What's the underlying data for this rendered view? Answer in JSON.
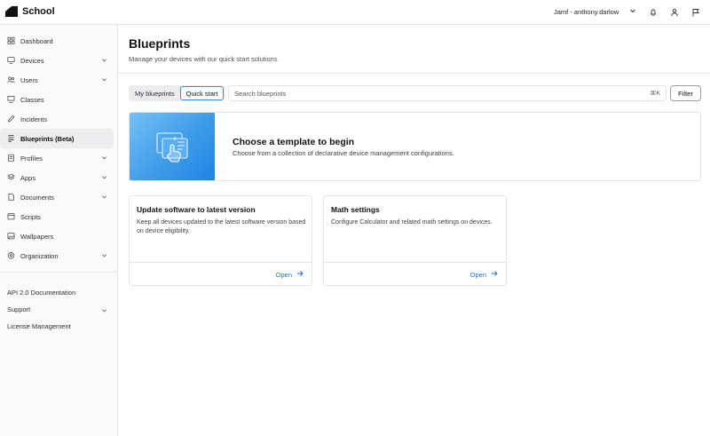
{
  "app": {
    "name": "School",
    "account": "Jamf - anthony.darlow"
  },
  "sidebar": {
    "items": [
      {
        "label": "Dashboard",
        "icon": "grid-icon",
        "chevron": false
      },
      {
        "label": "Devices",
        "icon": "monitor-icon",
        "chevron": true
      },
      {
        "label": "Users",
        "icon": "users-icon",
        "chevron": true
      },
      {
        "label": "Classes",
        "icon": "classroom-icon",
        "chevron": false
      },
      {
        "label": "Incidents",
        "icon": "pencil-icon",
        "chevron": false
      },
      {
        "label": "Blueprints (Beta)",
        "icon": "blueprint-icon",
        "chevron": false,
        "active": true
      },
      {
        "label": "Profiles",
        "icon": "profile-icon",
        "chevron": true
      },
      {
        "label": "Apps",
        "icon": "apps-icon",
        "chevron": true
      },
      {
        "label": "Documents",
        "icon": "document-icon",
        "chevron": true
      },
      {
        "label": "Scripts",
        "icon": "script-icon",
        "chevron": false
      },
      {
        "label": "Wallpapers",
        "icon": "image-icon",
        "chevron": false
      },
      {
        "label": "Organization",
        "icon": "gear-icon",
        "chevron": true
      }
    ],
    "footer_items": [
      {
        "label": "API 2.0 Documentation",
        "chevron": false
      },
      {
        "label": "Support",
        "chevron": true
      },
      {
        "label": "License Management",
        "chevron": false
      }
    ]
  },
  "page": {
    "title": "Blueprints",
    "subtitle": "Manage your devices with our quick start solutions"
  },
  "tabs": [
    {
      "label": "My blueprints",
      "selected": false
    },
    {
      "label": "Quick start",
      "selected": true
    }
  ],
  "search": {
    "placeholder": "Search blueprints",
    "shortcut": "⌘K"
  },
  "filter_label": "Filter",
  "banner": {
    "title": "Choose a template to begin",
    "subtitle": "Choose from a collection of declarative device management configurations."
  },
  "cards": [
    {
      "title": "Update software to latest version",
      "description": "Keep all devices updated to the latest software version based on device eligibility.",
      "link": "Open"
    },
    {
      "title": "Math settings",
      "description": "Configure Calculator and related math settings on devices.",
      "link": "Open"
    }
  ],
  "colors": {
    "accent": "#3a8de0",
    "link": "#1a6fd6",
    "banner_gradient_start": "#74c0f5",
    "banner_gradient_end": "#1e84e4"
  }
}
